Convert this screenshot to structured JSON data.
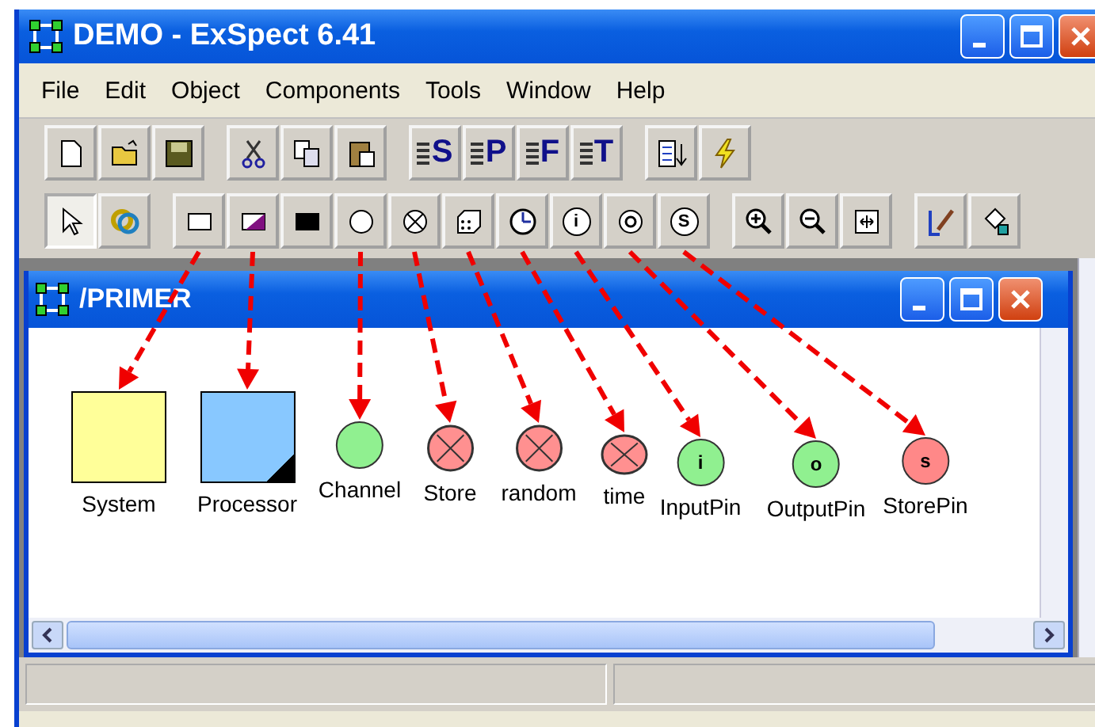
{
  "window": {
    "title": "DEMO - ExSpect 6.41"
  },
  "menu": [
    "File",
    "Edit",
    "Object",
    "Components",
    "Tools",
    "Window",
    "Help"
  ],
  "toolbar_1": [
    [
      {
        "kind": "new"
      },
      {
        "kind": "open"
      },
      {
        "kind": "save"
      }
    ],
    [
      {
        "kind": "cut"
      },
      {
        "kind": "copy"
      },
      {
        "kind": "paste"
      }
    ],
    [
      {
        "kind": "lines",
        "glyph": "S"
      },
      {
        "kind": "lines",
        "glyph": "P"
      },
      {
        "kind": "lines",
        "glyph": "F"
      },
      {
        "kind": "lines",
        "glyph": "T"
      }
    ],
    [
      {
        "kind": "sort"
      },
      {
        "kind": "bolt"
      }
    ]
  ],
  "toolbar_2": [
    [
      {
        "kind": "pointer",
        "selected": true
      },
      {
        "kind": "rings",
        "selected": false
      }
    ],
    [
      {
        "kind": "system",
        "selected": false
      },
      {
        "kind": "processor",
        "selected": false
      },
      {
        "kind": "block",
        "selected": false
      },
      {
        "kind": "channel",
        "selected": false
      },
      {
        "kind": "store",
        "selected": false
      },
      {
        "kind": "random",
        "selected": false
      },
      {
        "kind": "time",
        "selected": false
      },
      {
        "kind": "inputpin",
        "selected": false,
        "glyph": "i"
      },
      {
        "kind": "outputpin",
        "selected": false
      },
      {
        "kind": "storepin",
        "selected": false,
        "glyph": "S"
      }
    ],
    [
      {
        "kind": "zoomin",
        "selected": false
      },
      {
        "kind": "zoomout",
        "selected": false
      },
      {
        "kind": "fit",
        "selected": false
      }
    ],
    [
      {
        "kind": "brush",
        "selected": false
      },
      {
        "kind": "bucket",
        "selected": false
      }
    ]
  ],
  "child_window": {
    "title": "/PRIMER",
    "nodes": [
      {
        "kind": "system",
        "label": "System",
        "arrow": true
      },
      {
        "kind": "processor",
        "label": "Processor",
        "arrow": true
      },
      {
        "kind": "channel",
        "label": "Channel",
        "arrow": true
      },
      {
        "kind": "store",
        "label": "Store",
        "arrow": true
      },
      {
        "kind": "random",
        "label": "random",
        "arrow": true
      },
      {
        "kind": "time",
        "label": "time",
        "arrow": true
      },
      {
        "kind": "inputpin",
        "label": "InputPin",
        "symbol": "i",
        "arrow": true
      },
      {
        "kind": "outputpin",
        "label": "OutputPin",
        "symbol": "o",
        "arrow": true
      },
      {
        "kind": "storepin",
        "label": "StorePin",
        "symbol": "s",
        "arrow": true
      }
    ]
  }
}
